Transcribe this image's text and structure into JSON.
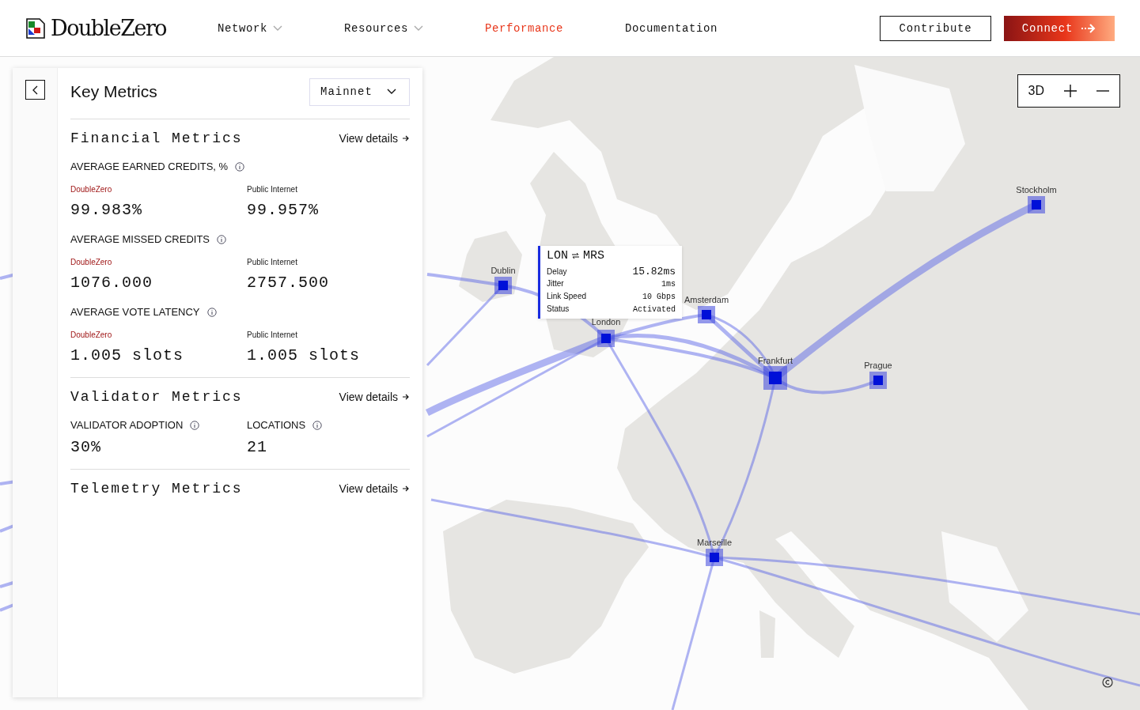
{
  "header": {
    "logo": "DoubleZero",
    "nav": [
      {
        "label": "Network",
        "dropdown": true,
        "selected": false
      },
      {
        "label": "Resources",
        "dropdown": true,
        "selected": false
      },
      {
        "label": "Performance",
        "dropdown": false,
        "selected": true
      },
      {
        "label": "Documentation",
        "dropdown": false,
        "selected": false
      }
    ],
    "buttons": [
      {
        "label": "Contribute",
        "kind": "outline"
      },
      {
        "label": "Connect",
        "kind": "primary"
      }
    ]
  },
  "panel": {
    "title": "Key Metrics",
    "network": "Mainnet",
    "sections": [
      {
        "title": "Financial Metrics",
        "link": "View details",
        "metrics": [
          {
            "kind": "comparison",
            "label": "AVERAGE EARNED CREDITS, %",
            "values": [
              {
                "source": "DoubleZero",
                "accent": true,
                "value": "99.983%"
              },
              {
                "source": "Public Internet",
                "accent": false,
                "value": "99.957%"
              }
            ]
          },
          {
            "kind": "comparison",
            "label": "AVERAGE MISSED CREDITS",
            "values": [
              {
                "source": "DoubleZero",
                "accent": true,
                "value": "1076.000"
              },
              {
                "source": "Public Internet",
                "accent": false,
                "value": "2757.500"
              }
            ]
          },
          {
            "kind": "comparison",
            "label": "AVERAGE VOTE LATENCY",
            "values": [
              {
                "source": "DoubleZero",
                "accent": true,
                "value": "1.005 slots"
              },
              {
                "source": "Public Internet",
                "accent": false,
                "value": "1.005 slots"
              }
            ]
          }
        ]
      },
      {
        "title": "Validator Metrics",
        "link": "View details",
        "metrics": [
          {
            "kind": "single",
            "label": "VALIDATOR ADOPTION",
            "value": "30%"
          },
          {
            "kind": "single",
            "label": "LOCATIONS",
            "value": "21"
          }
        ]
      },
      {
        "title": "Telemetry Metrics",
        "link": "View details"
      }
    ]
  },
  "map": {
    "view_toggle": "3D",
    "nodes": [
      {
        "label": "Stockholm"
      },
      {
        "label": "Dublin"
      },
      {
        "label": "Amsterdam"
      },
      {
        "label": "London"
      },
      {
        "label": "Frankfurt"
      },
      {
        "label": "Prague"
      },
      {
        "label": "Marseille"
      }
    ],
    "tooltip": {
      "from": "LON",
      "to": "MRS",
      "rows": [
        {
          "label": "Delay",
          "value": "15.82ms",
          "kind": "large"
        },
        {
          "label": "Jitter",
          "value": "1ms",
          "kind": "normal"
        },
        {
          "label": "Link Speed",
          "value": "10 Gbps",
          "kind": "normal"
        },
        {
          "label": "Status",
          "value": "Activated",
          "kind": "normal"
        }
      ]
    }
  }
}
